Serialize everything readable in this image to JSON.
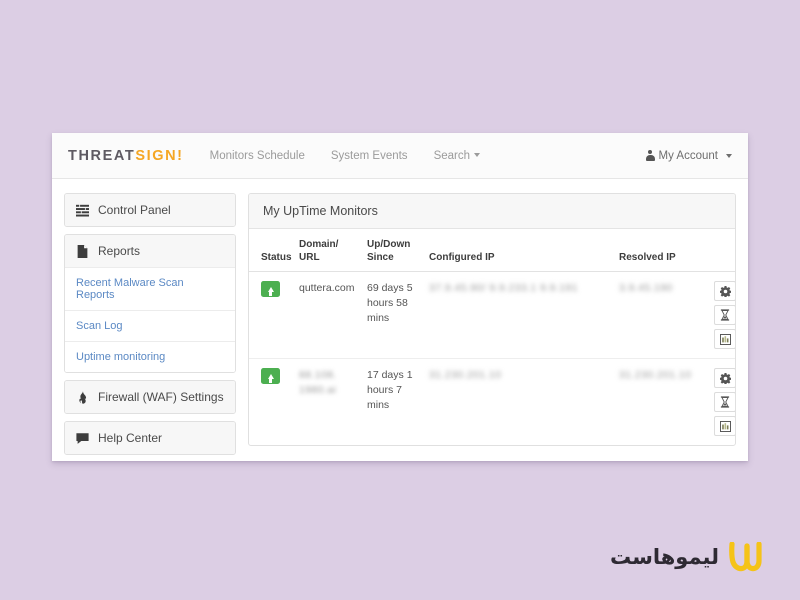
{
  "page": {
    "background_color": "#dccee4"
  },
  "navbar": {
    "brand_part1": "THREAT",
    "brand_part2": "SIGN!",
    "brand_color_1": "#5e5a62",
    "brand_color_2": "#f5a623",
    "links": [
      {
        "label": "Monitors Schedule",
        "icon": ""
      },
      {
        "label": "System Events",
        "icon": ""
      },
      {
        "label": "Search",
        "icon": "caret-down-icon"
      }
    ],
    "account": {
      "label": "My Account",
      "icon": "person-icon",
      "caret": "caret-down-icon"
    }
  },
  "sidebar": {
    "items": [
      {
        "label": "Control Panel",
        "icon": "list-lines-icon"
      },
      {
        "label": "Reports",
        "icon": "document-icon"
      },
      {
        "label": "Firewall (WAF) Settings",
        "icon": "flame-icon"
      },
      {
        "label": "Help Center",
        "icon": "speech-bubble-icon"
      }
    ],
    "reports_sub": [
      {
        "label": "Recent Malware Scan Reports"
      },
      {
        "label": "Scan Log"
      },
      {
        "label": "Uptime monitoring"
      }
    ],
    "link_color": "#5b89c4"
  },
  "main": {
    "panel_title": "My UpTime Monitors",
    "table": {
      "headers": [
        "Status",
        "Domain/ URL",
        "Up/Down Since",
        "Configured IP",
        "Resolved IP",
        ""
      ],
      "headers_multiline": [
        {
          "line1": "",
          "line2": "Status"
        },
        {
          "line1": "Domain/",
          "line2": "URL"
        },
        {
          "line1": "Up/Down",
          "line2": "Since"
        },
        {
          "line1": "",
          "line2": "Configured IP"
        },
        {
          "line1": "",
          "line2": "Resolved IP"
        },
        {
          "line1": "",
          "line2": ""
        }
      ],
      "rows": [
        {
          "status": "up",
          "status_icon": "arrow-up-icon",
          "status_color": "#4caf50",
          "domain": "quttera.com",
          "domain_redacted": false,
          "since": "69 days 5 hours 58 mins",
          "configured_ip": "37.9.45.90/ 9.9.233.1 9.9.191",
          "configured_ip_redacted": true,
          "resolved_ip": "3.9.45.190",
          "resolved_ip_redacted": true,
          "actions": [
            {
              "icon": "gear-icon",
              "label": "Settings"
            },
            {
              "icon": "hourglass-icon",
              "label": "History"
            },
            {
              "icon": "bar-chart-icon",
              "label": "Statistics"
            }
          ]
        },
        {
          "status": "up",
          "status_icon": "arrow-up-icon",
          "status_color": "#4caf50",
          "domain": "88.108. 1980.ai",
          "domain_redacted": true,
          "since": "17 days 1 hours 7 mins",
          "configured_ip": "31.230.201.10",
          "configured_ip_redacted": true,
          "resolved_ip": "31.230.201.10",
          "resolved_ip_redacted": true,
          "actions": [
            {
              "icon": "gear-icon",
              "label": "Settings"
            },
            {
              "icon": "hourglass-icon",
              "label": "History"
            },
            {
              "icon": "bar-chart-icon",
              "label": "Statistics"
            }
          ]
        }
      ]
    }
  },
  "watermark": {
    "text": "لیموهاست",
    "logo_color": "#f5c318",
    "text_color": "#2e2a33"
  }
}
